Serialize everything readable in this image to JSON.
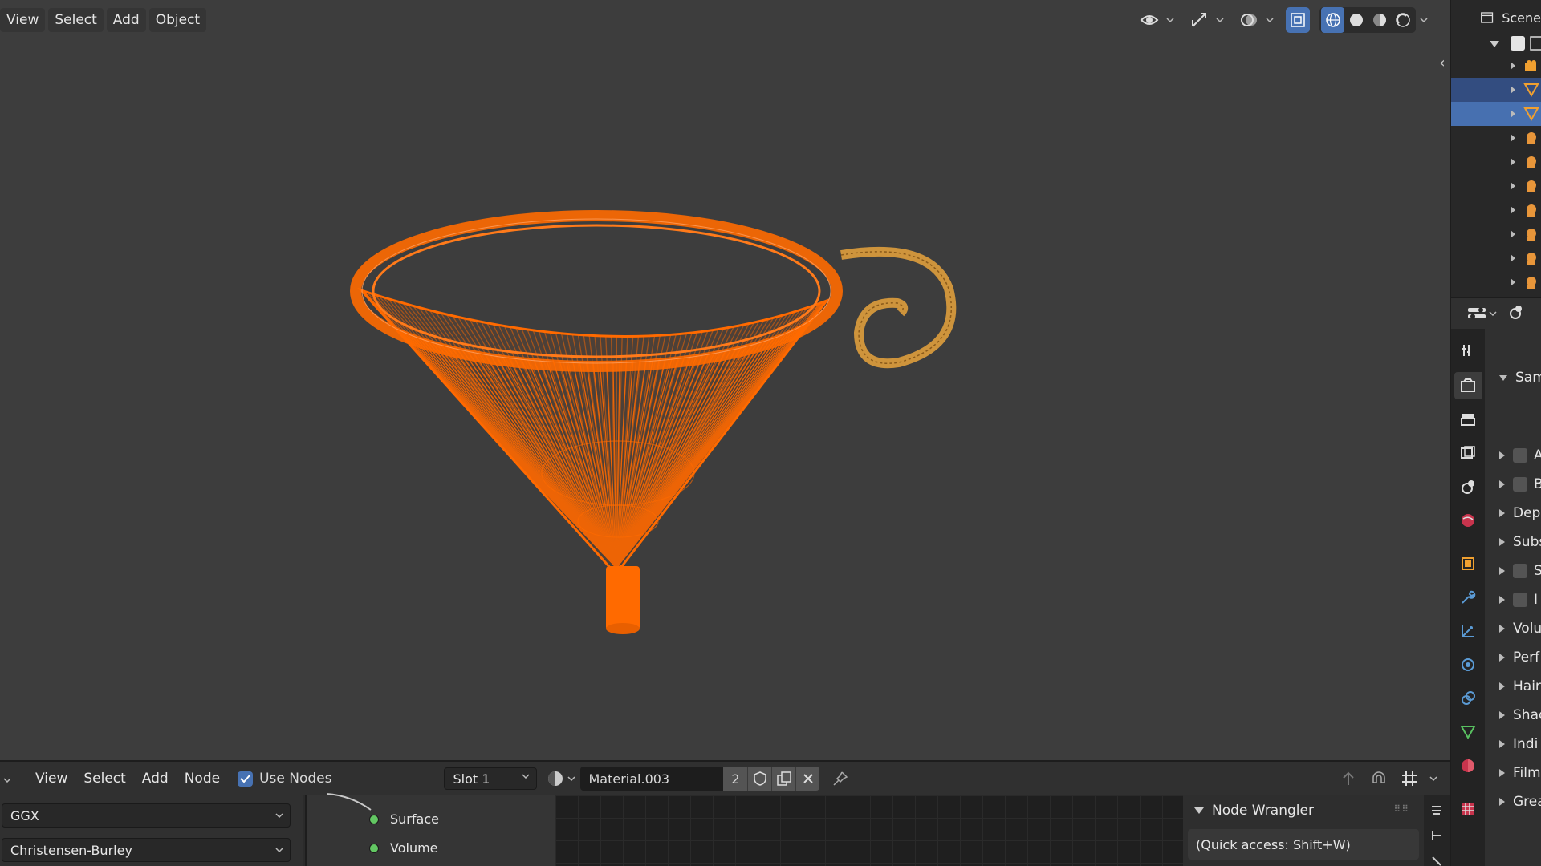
{
  "viewport": {
    "menu": [
      "View",
      "Select",
      "Add",
      "Object"
    ]
  },
  "node_editor": {
    "menu": [
      "View",
      "Select",
      "Add",
      "Node"
    ],
    "use_nodes_label": "Use Nodes",
    "slot": "Slot 1",
    "material_name": "Material.003",
    "user_count": "2",
    "distribution": "GGX",
    "subsurface_method": "Christensen-Burley",
    "sockets": [
      "Surface",
      "Volume"
    ],
    "node_wrangler": {
      "title": "Node Wrangler",
      "quick_access": "(Quick access: Shift+W)"
    }
  },
  "outliner": {
    "title": "Scene"
  },
  "properties": {
    "sections": [
      {
        "label": "Sam",
        "expanded": true
      },
      {
        "label": "A",
        "checkbox": true
      },
      {
        "label": "B",
        "checkbox": true
      },
      {
        "label": "Dep"
      },
      {
        "label": "Subs"
      },
      {
        "label": "S",
        "checkbox": true
      },
      {
        "label": "I",
        "checkbox": true
      },
      {
        "label": "Volu"
      },
      {
        "label": "Perf"
      },
      {
        "label": "Hair"
      },
      {
        "label": "Shad"
      },
      {
        "label": "Indi"
      },
      {
        "label": "Film"
      },
      {
        "label": "Grea"
      }
    ]
  },
  "colors": {
    "accent": "#4772b3",
    "object_orange": "#ff6a00",
    "curve_orange": "#e8a33c",
    "socket_green": "#63c763"
  }
}
